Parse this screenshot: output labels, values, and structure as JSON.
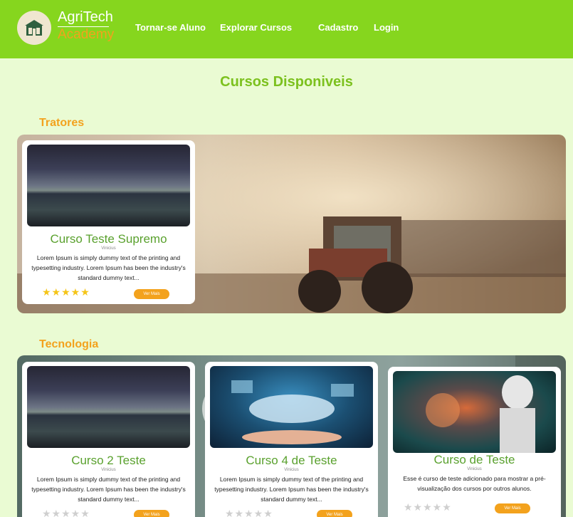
{
  "nav": {
    "brand_line1": "AgriTech",
    "brand_line2": "Academy",
    "links": [
      "Tornar-se Aluno",
      "Explorar Cursos",
      "Cadastro",
      "Login"
    ]
  },
  "page_title": "Cursos Disponiveis",
  "colors": {
    "nav_bg": "#86d61e",
    "page_bg": "#eafbd3",
    "accent": "#f3a21d",
    "title": "#7cc11e",
    "card_title": "#5aa12e"
  },
  "categories": [
    {
      "name": "Tratores",
      "courses": [
        {
          "title": "Curso Teste Supremo",
          "author": "Vinicius",
          "desc": "Lorem Ipsum is simply dummy text of the printing and typesetting industry. Lorem Ipsum has been the industry's standard dummy text...",
          "stars": "★★★★★",
          "button": "Ver Mais"
        }
      ]
    },
    {
      "name": "Tecnologia",
      "courses": [
        {
          "title": "Curso 2 Teste",
          "author": "Vinicius",
          "desc": "Lorem Ipsum is simply dummy text of the printing and typesetting industry. Lorem Ipsum has been the industry's standard dummy text...",
          "stars": "★★★★★",
          "button": "Ver Mais"
        },
        {
          "title": "Curso 4 de Teste",
          "author": "Vinicius",
          "desc": "Lorem Ipsum is simply dummy text of the printing and typesetting industry. Lorem Ipsum has been the industry's standard dummy text...",
          "stars": "★★★★★",
          "button": "Ver Mais"
        },
        {
          "title": "Curso de Teste",
          "author": "Vinicius",
          "desc": "Esse é curso de teste adicionado para mostrar a pré-visualização dos cursos por outros alunos.",
          "stars": "★★★★★",
          "button": "Ver Mais"
        }
      ]
    }
  ]
}
